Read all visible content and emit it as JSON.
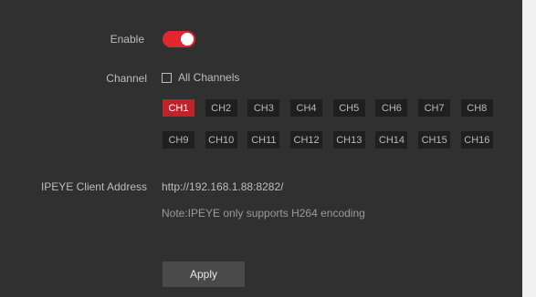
{
  "enable": {
    "label": "Enable",
    "state": "on",
    "accent_color": "#e0262f"
  },
  "channel": {
    "label": "Channel",
    "all_channels_label": "All Channels",
    "all_channels_checked": false,
    "selected_channel": "CH1",
    "channels": [
      "CH1",
      "CH2",
      "CH3",
      "CH4",
      "CH5",
      "CH6",
      "CH7",
      "CH8",
      "CH9",
      "CH10",
      "CH11",
      "CH12",
      "CH13",
      "CH14",
      "CH15",
      "CH16"
    ]
  },
  "ipeye": {
    "label": "IPEYE Client Address",
    "address": "http://192.168.1.88:8282/",
    "note": "Note:IPEYE only supports H264 encoding"
  },
  "apply_label": "Apply"
}
